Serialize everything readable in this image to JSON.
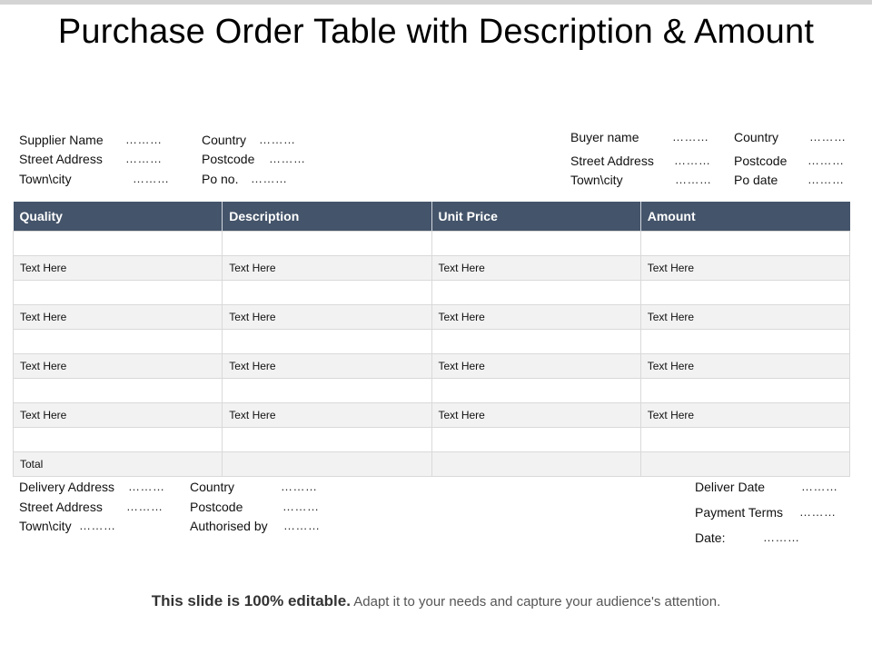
{
  "title": "Purchase Order Table with Description & Amount",
  "placeholder_dots": "………",
  "supplier": {
    "col1": [
      "Supplier Name",
      "Street Address",
      "Town\\city"
    ],
    "col2": [
      "Country",
      "Postcode",
      "Po no."
    ]
  },
  "buyer": {
    "col1": [
      "Buyer name",
      "Street Address",
      "Town\\city"
    ],
    "col2": [
      "Country",
      "Postcode",
      "Po date"
    ]
  },
  "table": {
    "headers": [
      "Quality",
      "Description",
      "Unit Price",
      "Amount"
    ],
    "rows": [
      [
        "",
        "",
        "",
        ""
      ],
      [
        "Text Here",
        "Text Here",
        "Text Here",
        "Text Here"
      ],
      [
        "",
        "",
        "",
        ""
      ],
      [
        "Text Here",
        "Text Here",
        "Text Here",
        "Text Here"
      ],
      [
        "",
        "",
        "",
        ""
      ],
      [
        "Text Here",
        "Text Here",
        "Text Here",
        "Text Here"
      ],
      [
        "",
        "",
        "",
        ""
      ],
      [
        "Text Here",
        "Text Here",
        "Text Here",
        "Text Here"
      ],
      [
        "",
        "",
        "",
        ""
      ],
      [
        "Total",
        "",
        "",
        ""
      ]
    ],
    "header_color": "#44546a"
  },
  "delivery": {
    "col1": [
      "Delivery Address",
      "Street Address",
      "Town\\city"
    ],
    "col2": [
      "Country",
      "Postcode",
      "Authorised by"
    ]
  },
  "terms": [
    "Deliver Date",
    "Payment Terms",
    "Date:"
  ],
  "footer": {
    "bold": "This slide is 100% editable.",
    "normal": " Adapt it to your needs and capture your audience's attention."
  }
}
